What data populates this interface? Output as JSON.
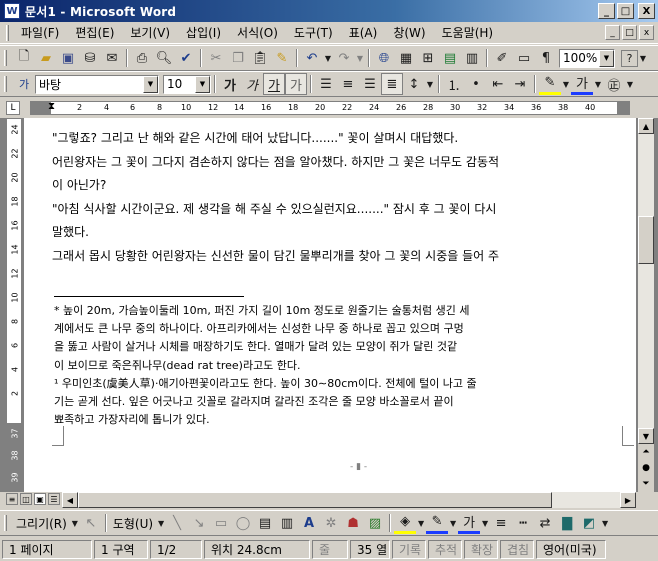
{
  "window": {
    "app_icon": "W",
    "title": "문서1 - Microsoft Word",
    "minimize": "_",
    "maximize": "□",
    "close": "X"
  },
  "menu": {
    "items": [
      "파일(F)",
      "편집(E)",
      "보기(V)",
      "삽입(I)",
      "서식(O)",
      "도구(T)",
      "표(A)",
      "창(W)",
      "도움말(H)"
    ],
    "doc_controls": [
      "_",
      "□",
      "x"
    ]
  },
  "standard_toolbar": {
    "zoom_value": "100%",
    "help_label": "?"
  },
  "format_toolbar": {
    "style_label": "가",
    "font_name": "바탕",
    "font_size": "10",
    "bold": "가",
    "italic": "가",
    "outline": "가",
    "shadow": "가",
    "font_color_label": "가",
    "highlight_label": "가"
  },
  "ruler": {
    "ticks": [
      "2",
      "4",
      "6",
      "8",
      "10",
      "12",
      "14",
      "16",
      "18",
      "20",
      "22",
      "24",
      "26",
      "28",
      "30",
      "32",
      "34",
      "36",
      "38",
      "40"
    ],
    "vertical_ticks": [
      "24",
      "22",
      "20",
      "18",
      "16",
      "14",
      "12",
      "10",
      "8",
      "6",
      "4",
      "2",
      "37",
      "38",
      "39"
    ]
  },
  "document": {
    "paragraphs": [
      "\"그렇죠? 그리고 난 해와 같은 시간에 태어 났답니다.......\" 꽃이 살며시 대답했다.",
      "어린왕자는 그 꽃이 그다지 겸손하지 않다는 점을 알아챘다. 하지만 그 꽃은 너무도 감동적",
      "이 아닌가?",
      "\"아침 식사할 시간이군요. 제 생각을 해 주실 수 있으실런지요.......\" 잠시 후 그 꽃이 다시",
      "말했다.",
      "그래서 몹시 당황한 어린왕자는 신선한 물이 담긴 물뿌리개를 찾아 그 꽃의 시중을 들어 주"
    ],
    "footnotes": [
      "* 높이 20m, 가슴높이둘레 10m, 퍼진 가지 길이 10m 정도로 원줄기는 술통처럼 생긴 세",
      "계에서도 큰 나무 중의 하나이다. 아프리카에서는 신성한 나무 중 하나로 꼽고 있으며 구멍",
      "을 뚫고 사람이 살거나 시체를 매장하기도 한다. 열매가 달려 있는 모양이 쥐가 달린 것같",
      "이 보이므로 죽은쥐나무(dead rat tree)라고도 한다.",
      "¹ 우미인초(虞美人草)·애기아편꽃이라고도 한다. 높이 30∼80cm이다. 전체에 털이 나고 줄",
      "기는 곧게 선다. 잎은 어긋나고 깃꼴로 갈라지며 갈라진 조각은 줄 모양 바소꼴로서 끝이",
      "뾰족하고 가장자리에 톱니가 있다."
    ]
  },
  "drawing_toolbar": {
    "draw_menu": "그리기(R)",
    "autoshapes_menu": "도형(U)",
    "font_color_label": "가"
  },
  "status": {
    "page": "1 페이지",
    "section": "1 구역",
    "page_of": "1/2",
    "position": "위치 24.8cm",
    "line": "줄",
    "column": "35 열",
    "rec": "기록",
    "trk": "추적",
    "ext": "확장",
    "ovr": "겹침",
    "language": "영어(미국)"
  }
}
